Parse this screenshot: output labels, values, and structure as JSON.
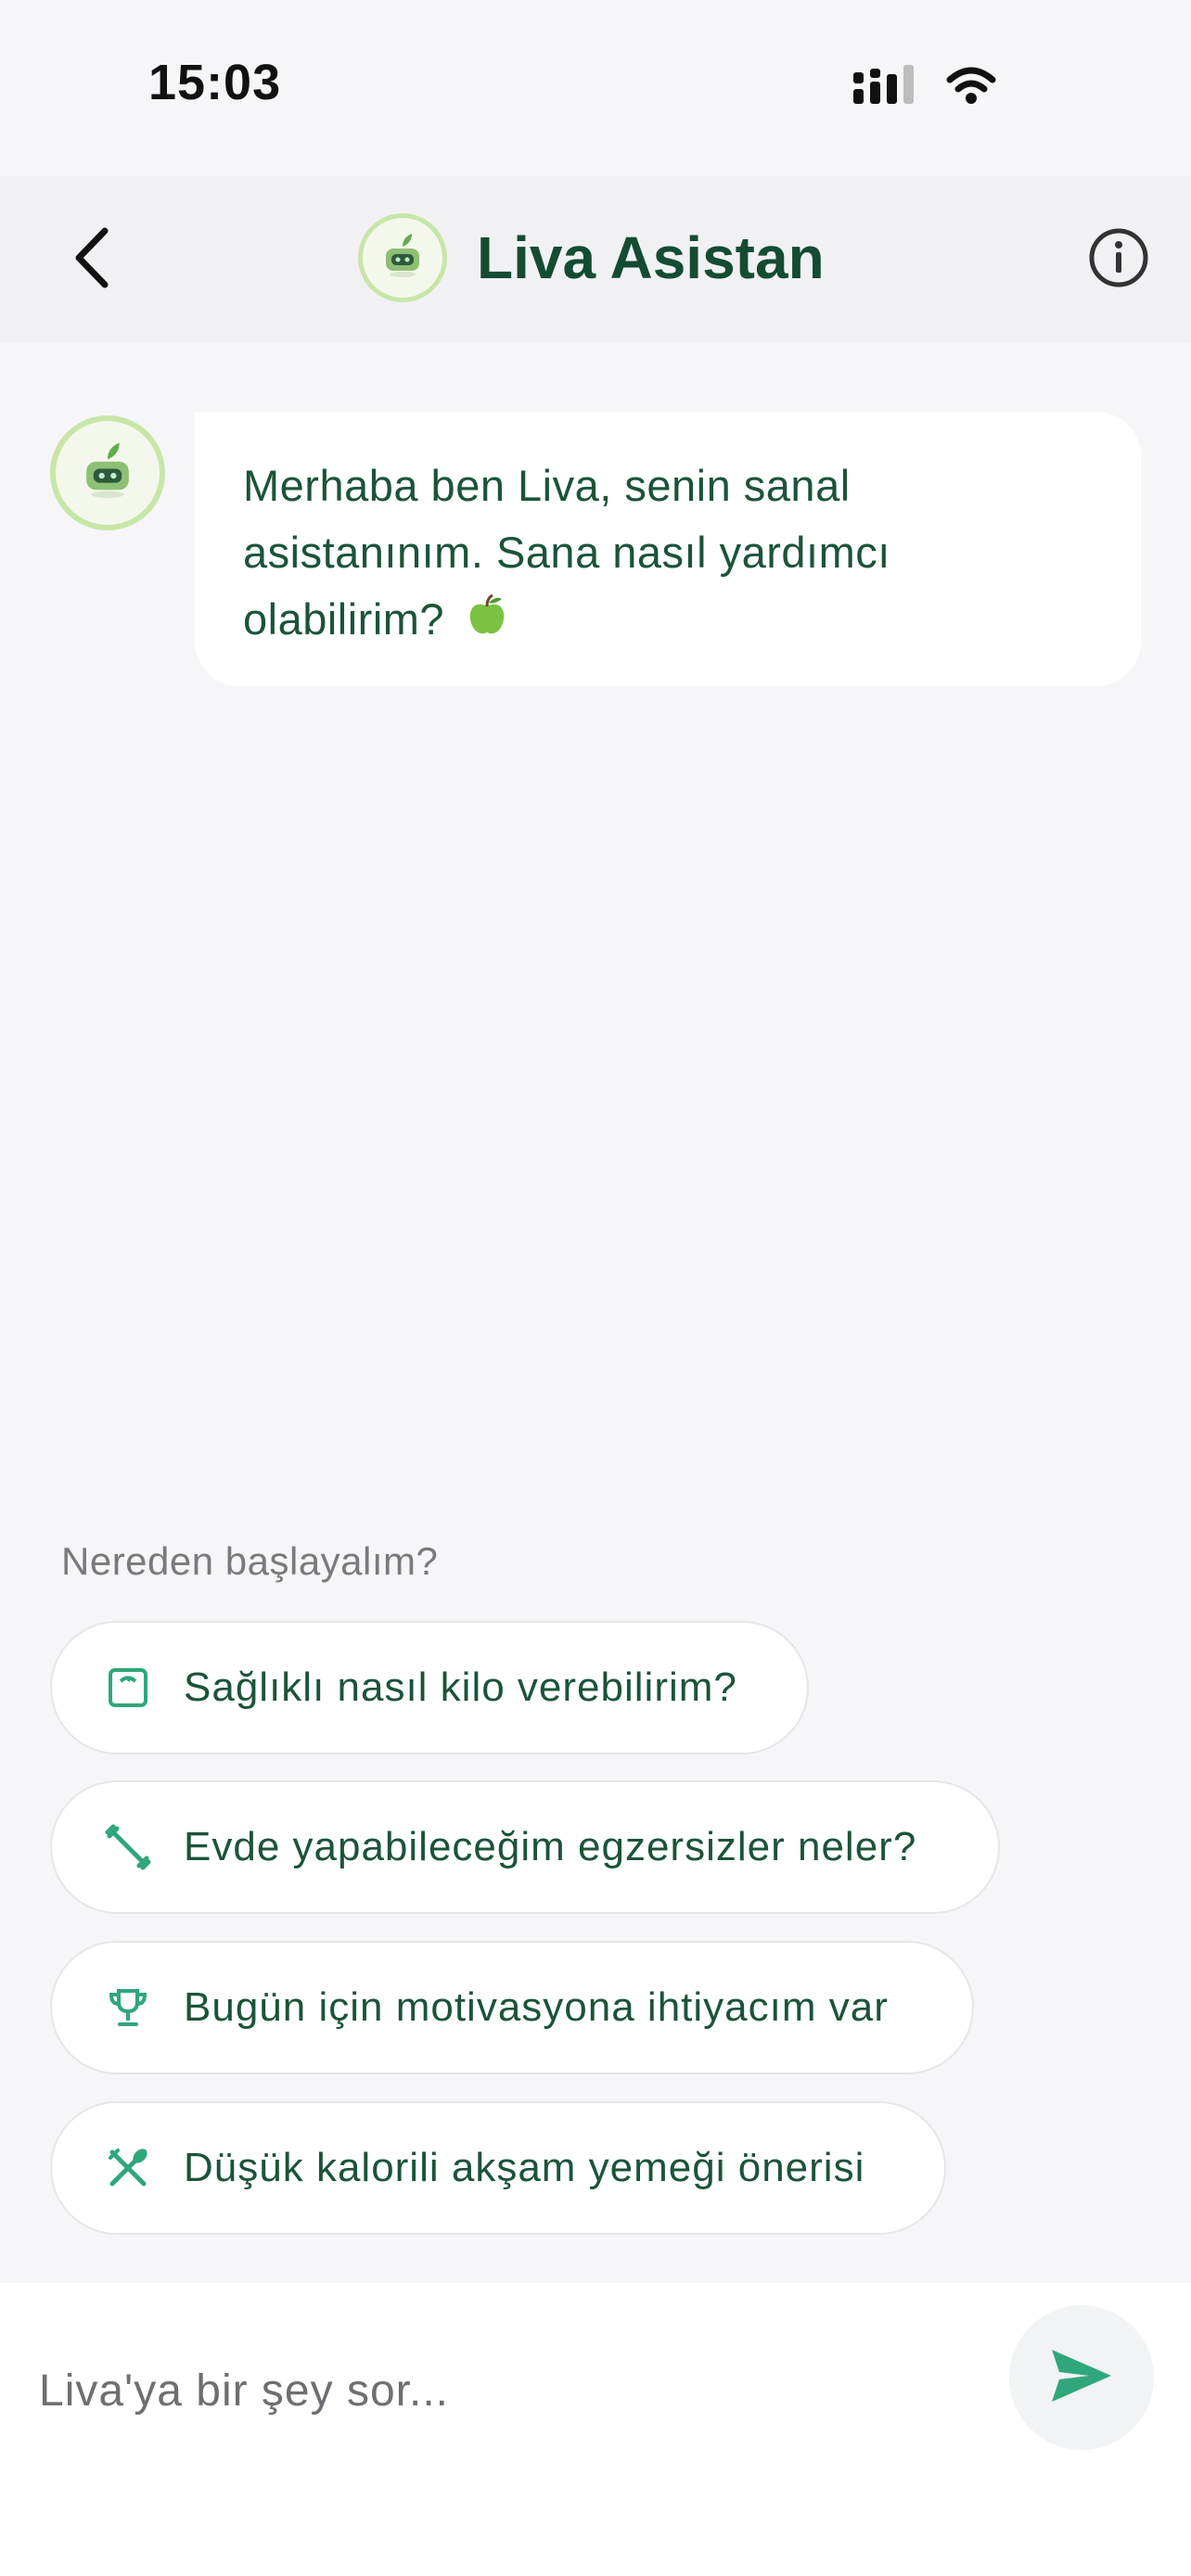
{
  "status_bar": {
    "time": "15:03",
    "signal_icon": "signal-bars-icon",
    "wifi_icon": "wifi-icon"
  },
  "header": {
    "back_icon": "chevron-left-icon",
    "title": "Liva Asistan",
    "avatar_icon": "robot-sprout-icon",
    "info_icon": "info-circle-icon"
  },
  "messages": [
    {
      "sender": "assistant",
      "text": "Merhaba ben Liva, senin sanal asistanınım. Sana nasıl yardımcı olabilirim?",
      "emoji": "green-apple-icon"
    }
  ],
  "suggestions": {
    "label": "Nereden başlayalım?",
    "items": [
      {
        "icon": "scale-icon",
        "label": "Sağlıklı nasıl kilo verebilirim?"
      },
      {
        "icon": "dumbbell-icon",
        "label": "Evde yapabileceğim egzersizler neler?"
      },
      {
        "icon": "trophy-icon",
        "label": "Bugün için motivasyona ihtiyacım var"
      },
      {
        "icon": "utensils-icon",
        "label": "Düşük kalorili akşam yemeği önerisi"
      }
    ]
  },
  "composer": {
    "placeholder": "Liva'ya bir şey sor...",
    "value": "",
    "send_icon": "send-icon"
  },
  "colors": {
    "brand_dark_green": "#144b33",
    "accent_green": "#2fa77a",
    "avatar_ring": "#c8e6a8",
    "background": "#f6f6f8"
  }
}
